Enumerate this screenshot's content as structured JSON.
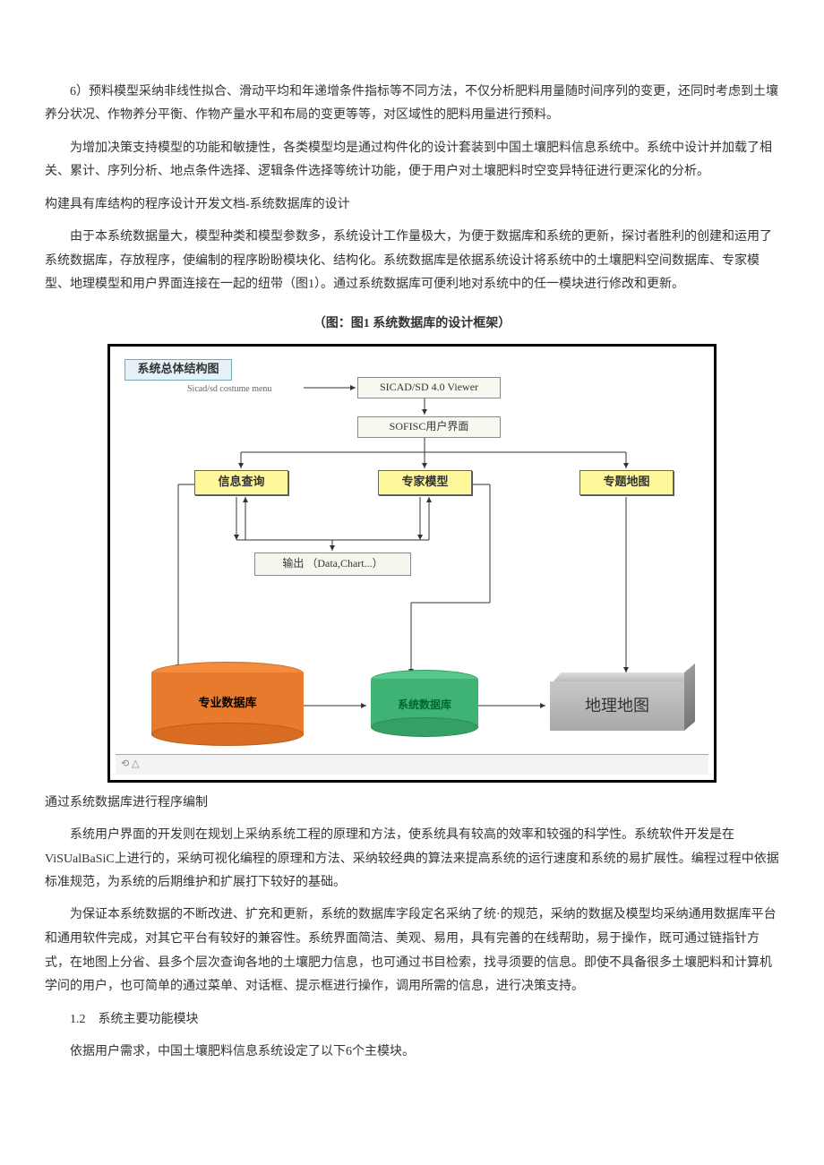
{
  "p1": "6）预料模型采纳非线性拟合、滑动平均和年递增条件指标等不同方法，不仅分析肥料用量随时间序列的变更，还同时考虑到土壤养分状况、作物养分平衡、作物产量水平和布局的变更等等，对区域性的肥料用量进行预料。",
  "p2": "为增加决策支持模型的功能和敏捷性，各类模型均是通过构件化的设计套装到中国土壤肥料信息系统中。系统中设计并加载了相关、累计、序列分析、地点条件选择、逻辑条件选择等统计功能，便于用户对土壤肥料时空变异特征进行更深化的分析。",
  "p3": "构建具有库结构的程序设计开发文档-系统数据库的设计",
  "p4": "由于本系统数据量大，模型种类和模型参数多，系统设计工作量极大，为便于数据库和系统的更新，探讨者胜利的创建和运用了系统数据库，存放程序，使编制的程序盼盼模块化、结构化。系统数据库是依据系统设计将系统中的土壤肥料空间数据库、专家模型、地理模型和用户界面连接在一起的纽带（图1）。通过系统数据库可便利地对系统中的任一模块进行修改和更新。",
  "fig_caption": "（图：图1 系统数据库的设计框架）",
  "diagram": {
    "title": "系统总体结构图",
    "menu": "Sicad/sd costume menu",
    "viewer": "SICAD/SD 4.0 Viewer",
    "ui": "SOFISC用户界面",
    "query": "信息查询",
    "expert": "专家模型",
    "thematic": "专题地图",
    "output": "输出 （Data,Chart...）",
    "prof_db": "专业数据库",
    "sys_db": "系统数据库",
    "geo_map": "地理地图",
    "footer_icon": "⟲ △"
  },
  "p5": "通过系统数据库进行程序编制",
  "p6": "系统用户界面的开发则在规划上采纳系统工程的原理和方法，使系统具有较高的效率和较强的科学性。系统软件开发是在ViSUalBaSiC上进行的，采纳可视化编程的原理和方法、采纳较经典的算法来提高系统的运行速度和系统的易扩展性。编程过程中依据标准规范，为系统的后期维护和扩展打下较好的基础。",
  "p7": "为保证本系统数据的不断改进、扩充和更新，系统的数据库字段定名采纳了统·的规范，采纳的数据及模型均采纳通用数据库平台和通用软件完成，对其它平台有较好的兼容性。系统界面简洁、美观、易用，具有完善的在线帮助，易于操作，既可通过链指针方式，在地图上分省、县多个层次查询各地的土壤肥力信息，也可通过书目检索，找寻须要的信息。即使不具备很多土壤肥料和计算机学问的用户，也可简单的通过菜单、对话框、提示框进行操作，调用所需的信息，进行决策支持。",
  "p8": "1.2　系统主要功能模块",
  "p9": "依据用户需求，中国土壤肥料信息系统设定了以下6个主模块。"
}
